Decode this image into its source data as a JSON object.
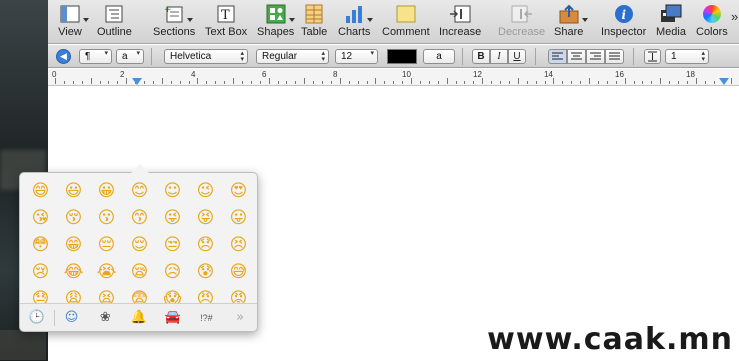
{
  "toolbar": {
    "items": [
      {
        "label": "View",
        "icon": "view-icon"
      },
      {
        "label": "Outline",
        "icon": "outline-icon"
      },
      {
        "label": "Sections",
        "icon": "sections-icon"
      },
      {
        "label": "Text Box",
        "icon": "textbox-icon"
      },
      {
        "label": "Shapes",
        "icon": "shapes-icon"
      },
      {
        "label": "Table",
        "icon": "table-icon"
      },
      {
        "label": "Charts",
        "icon": "charts-icon"
      },
      {
        "label": "Comment",
        "icon": "comment-icon"
      },
      {
        "label": "Increase",
        "icon": "increase-icon"
      },
      {
        "label": "Decrease",
        "icon": "decrease-icon"
      },
      {
        "label": "Share",
        "icon": "share-icon"
      },
      {
        "label": "Inspector",
        "icon": "inspector-icon"
      },
      {
        "label": "Media",
        "icon": "media-icon"
      },
      {
        "label": "Colors",
        "icon": "colors-icon"
      }
    ]
  },
  "formatbar": {
    "paragraph_glyph": "¶",
    "char_style": "a",
    "font_family": "Helvetica",
    "font_typeface": "Regular",
    "font_size": "12",
    "highlight_char": "a",
    "bold": "B",
    "italic": "I",
    "underline": "U",
    "line_spacing": "1"
  },
  "ruler": {
    "numbers": [
      "0",
      "2",
      "4",
      "6",
      "8",
      "10",
      "12",
      "14",
      "16",
      "18"
    ]
  },
  "emoji_picker": {
    "emojis": [
      "😄",
      "😃",
      "😀",
      "😊",
      "☺",
      "😉",
      "😍",
      "😘",
      "😚",
      "😗",
      "😙",
      "😜",
      "😝",
      "😛",
      "😳",
      "😁",
      "😔",
      "😌",
      "😒",
      "😞",
      "😣",
      "😢",
      "😂",
      "😭",
      "😪",
      "😥",
      "😰",
      "😅",
      "😓",
      "😩",
      "😫",
      "😨",
      "😱",
      "😠",
      "😡"
    ],
    "categories": [
      {
        "name": "recent",
        "glyph": "🕒"
      },
      {
        "name": "people",
        "glyph": "☺"
      },
      {
        "name": "nature",
        "glyph": "❀"
      },
      {
        "name": "objects",
        "glyph": "🔔"
      },
      {
        "name": "places",
        "glyph": "🚘"
      },
      {
        "name": "symbols",
        "glyph": "!?#"
      },
      {
        "name": "more",
        "glyph": "»"
      }
    ]
  },
  "watermark": "www.caak.mn",
  "colors": {
    "accent": "#4a90d9",
    "emoji_yellow": "#e8a619"
  }
}
